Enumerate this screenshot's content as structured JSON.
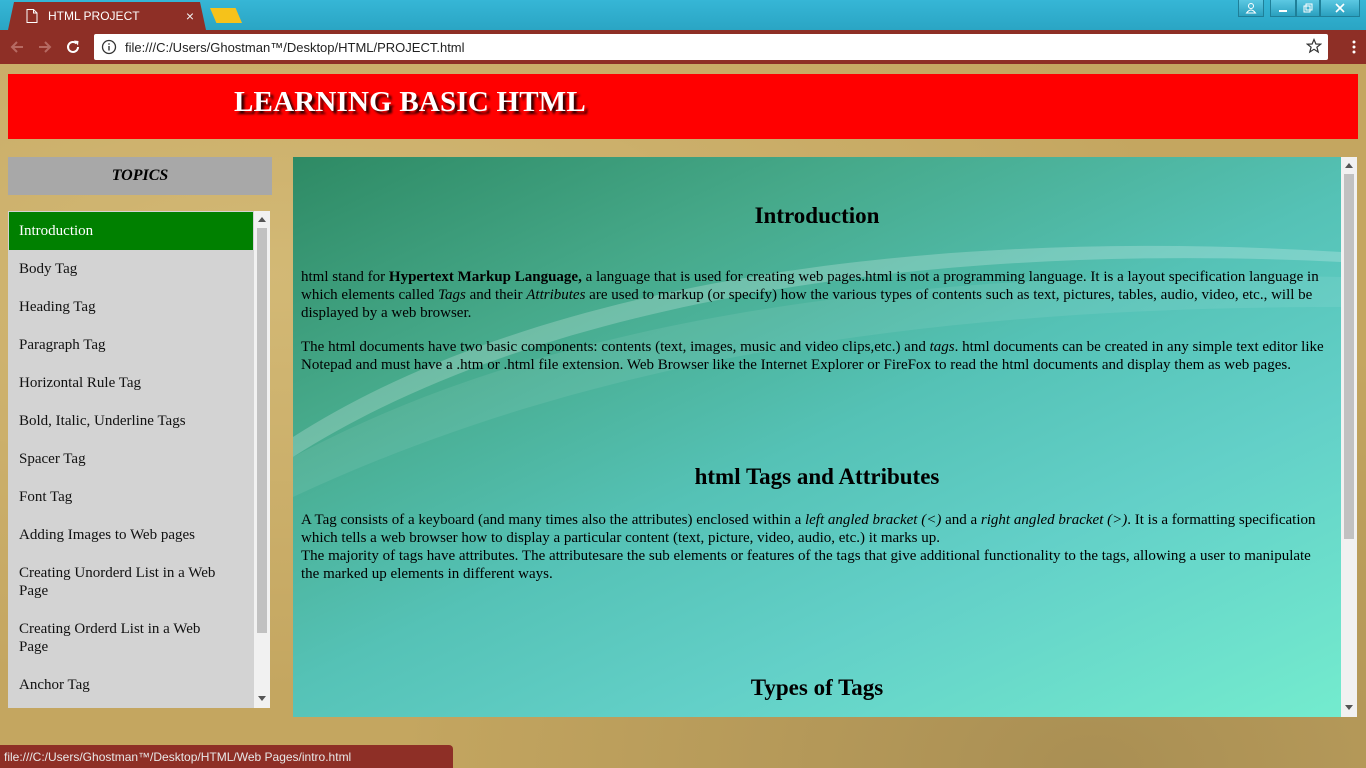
{
  "browser": {
    "tab_title": "HTML PROJECT",
    "tab_close": "×",
    "url": "file:///C:/Users/Ghostman™/Desktop/HTML/PROJECT.html",
    "status_url": "file:///C:/Users/Ghostman™/Desktop/HTML/Web Pages/intro.html"
  },
  "banner": {
    "title": "LEARNING BASIC HTML"
  },
  "topics": {
    "title": "TOPICS",
    "items": [
      "Introduction",
      "Body Tag",
      "Heading Tag",
      "Paragraph Tag",
      "Horizontal Rule Tag",
      "Bold, Italic, Underline Tags",
      "Spacer Tag",
      "Font Tag",
      "Adding Images to Web pages",
      "Creating Unorderd List in a Web Page",
      "Creating Orderd List in a Web Page",
      "Anchor Tag"
    ],
    "active_index": 0
  },
  "content": {
    "intro_heading": "Introduction",
    "intro_p1": {
      "a": "html stand for ",
      "b": "Hypertext Markup Language,",
      "c": " a language that is used for creating web pages.html is not a programming language. It is a layout specification language in which elements called ",
      "d": "Tags",
      "e": " and their ",
      "f": "Attributes",
      "g": " are used to markup (or specify) how the various types of contents such as text, pictures, tables, audio, video, etc., will be displayed by a web browser."
    },
    "intro_p2": {
      "a": "The html documents have two basic components: contents (text, images, music and video clips,etc.) and ",
      "b": "tags",
      "c": ". html documents can be created in any simple text editor like Notepad and must have a .htm or .html file extension. Web Browser like the Internet Explorer or FireFox to read the html documents and display them as web pages."
    },
    "tags_heading": "html Tags and Attributes",
    "tags_p1": {
      "a": "A Tag consists of a keyboard (and many times also the attributes) enclosed within a ",
      "b": "left angled bracket (<)",
      "c": " and a ",
      "d": "right angled bracket (>)",
      "e": ". It is a formatting specification which tells a web browser how to display a particular content (text, picture, video, audio, etc.) it marks up."
    },
    "tags_p2": "The majority of tags have attributes. The attributesare the sub elements or features of the tags that give additional functionality to the tags, allowing a user to manipulate the marked up elements in different ways.",
    "types_heading": "Types of Tags"
  },
  "colors": {
    "chrome": "#8e2f26",
    "banner": "#ff0000",
    "active_item": "#008000",
    "sidebar": "#d3d3d3"
  }
}
